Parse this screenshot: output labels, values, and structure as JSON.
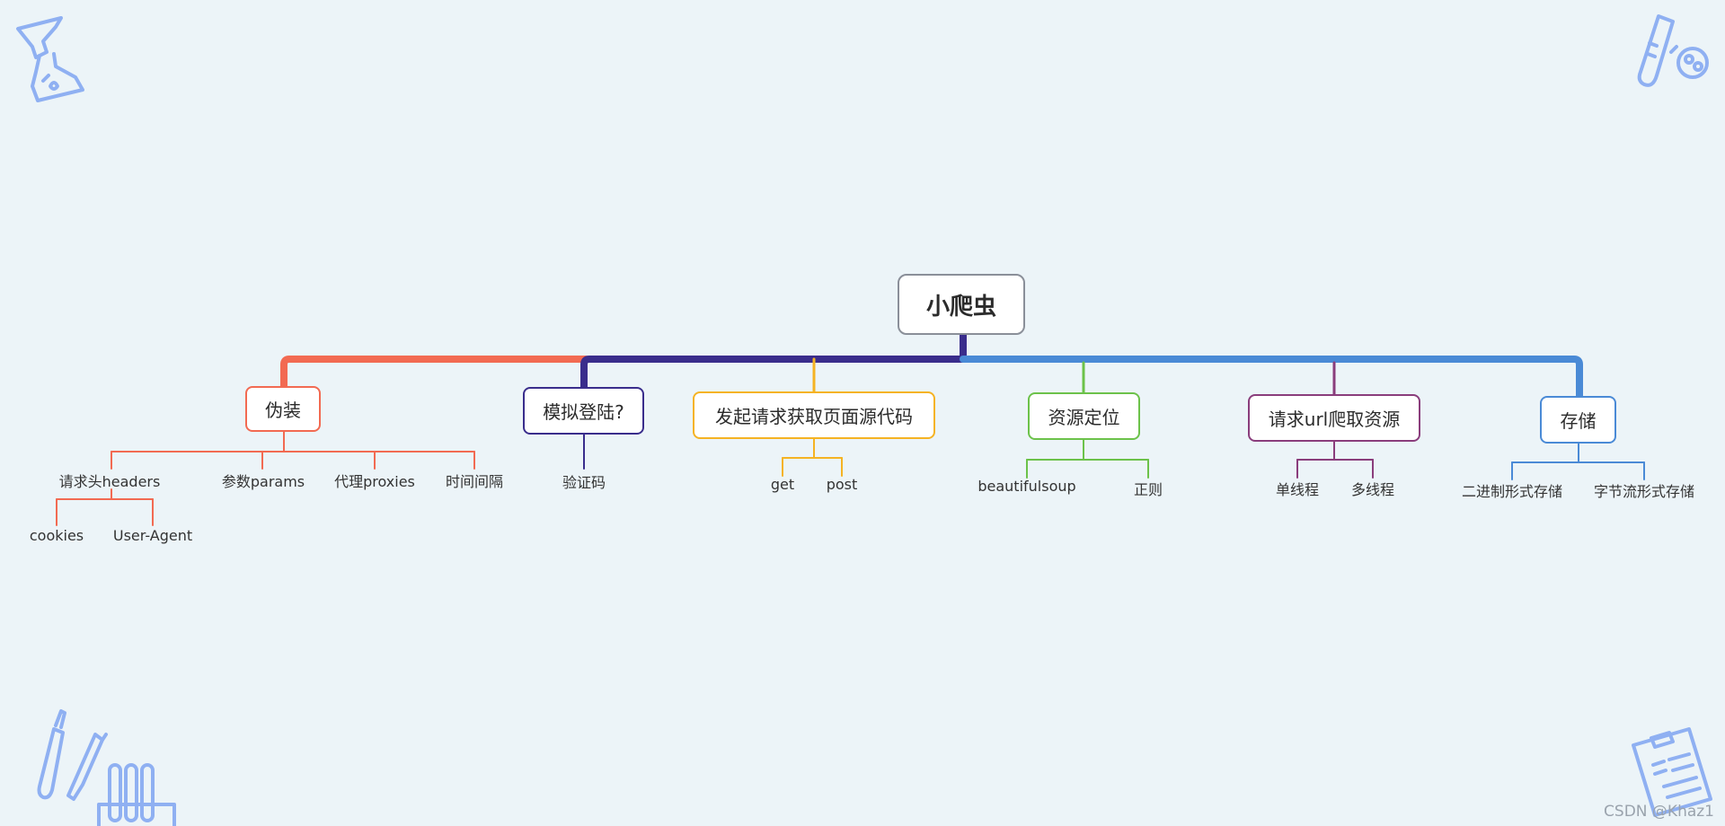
{
  "root": {
    "label": "小爬虫"
  },
  "branches": [
    {
      "label": "伪装",
      "color": "#f26a52"
    },
    {
      "label": "模拟登陆?",
      "color": "#3a2d8c"
    },
    {
      "label": "发起请求获取页面源代码",
      "color": "#f5b323"
    },
    {
      "label": "资源定位",
      "color": "#6cc24a"
    },
    {
      "label": "请求url爬取资源",
      "color": "#8a3d7c"
    },
    {
      "label": "存储",
      "color": "#4a8ad6"
    }
  ],
  "leaves": {
    "disguise": [
      "请求头headers",
      "参数params",
      "代理proxies",
      "时间间隔"
    ],
    "headers_children": [
      "cookies",
      "User-Agent"
    ],
    "login": [
      "验证码"
    ],
    "request": [
      "get",
      "post"
    ],
    "locate": [
      "beautifulsoup",
      "正则"
    ],
    "crawl": [
      "单线程",
      "多线程"
    ],
    "storage": [
      "二进制形式存储",
      "字节流形式存储"
    ]
  },
  "icons": [
    "funnel-flask-icon",
    "thermometer-petri-icon",
    "dropper-test-tubes-icon",
    "clipboard-icon"
  ],
  "watermark": "CSDN @Khaz1"
}
